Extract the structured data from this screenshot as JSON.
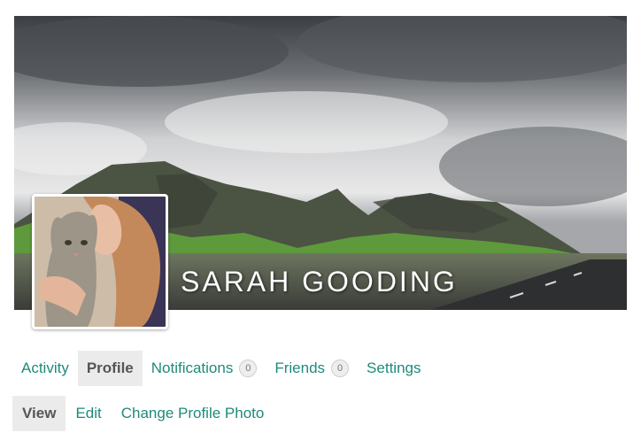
{
  "profile": {
    "name": "SARAH GOODING"
  },
  "nav": {
    "tabs": [
      {
        "label": "Activity",
        "active": false
      },
      {
        "label": "Profile",
        "active": true
      },
      {
        "label": "Notifications",
        "badge": "0",
        "active": false
      },
      {
        "label": "Friends",
        "badge": "0",
        "active": false
      },
      {
        "label": "Settings",
        "active": false
      }
    ]
  },
  "subnav": {
    "tabs": [
      {
        "label": "View",
        "active": true
      },
      {
        "label": "Edit",
        "active": false
      },
      {
        "label": "Change Profile Photo",
        "active": false
      }
    ]
  },
  "colors": {
    "link": "#1f8a7a",
    "active_tab_bg": "#ebebeb",
    "active_tab_text": "#555555"
  }
}
